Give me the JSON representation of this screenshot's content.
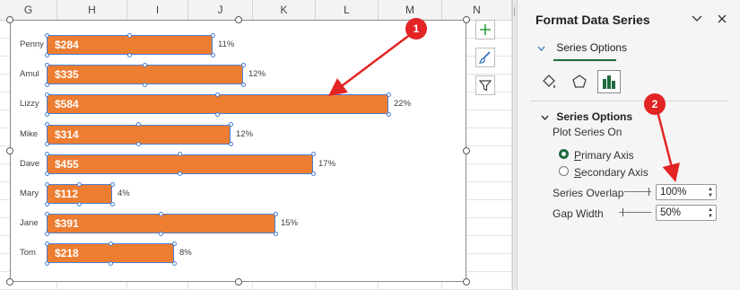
{
  "sheet": {
    "columns": [
      "G",
      "H",
      "I",
      "J",
      "K",
      "L",
      "M",
      "N"
    ]
  },
  "chart_data": {
    "type": "bar",
    "orientation": "horizontal",
    "categories": [
      "Penny",
      "Amul",
      "Lizzy",
      "Mike",
      "Dave",
      "Mary",
      "Jane",
      "Tom"
    ],
    "values": [
      284,
      335,
      584,
      314,
      455,
      112,
      391,
      218
    ],
    "value_labels": [
      "$284",
      "$335",
      "$584",
      "$314",
      "$455",
      "$112",
      "$391",
      "$218"
    ],
    "percent_labels": [
      "11%",
      "12%",
      "22%",
      "12%",
      "17%",
      "4%",
      "15%",
      "8%"
    ],
    "bar_color": "#ED7D31",
    "xlim": [
      0,
      584
    ],
    "selected": true
  },
  "chart_buttons": [
    {
      "icon": "plus-icon",
      "name": "chart-elements-button"
    },
    {
      "icon": "brush-icon",
      "name": "chart-styles-button"
    },
    {
      "icon": "filter-icon",
      "name": "chart-filters-button"
    }
  ],
  "pane": {
    "title": "Format Data Series",
    "series_options_tab": "Series Options",
    "section_title": "Series Options",
    "plot_series_on": "Plot Series On",
    "primary_axis": "Primary Axis",
    "secondary_axis": "Secondary Axis",
    "series_overlap_label": "Series Overlap",
    "series_overlap_value": "100%",
    "gap_width_label": "Gap Width",
    "gap_width_value": "50%",
    "primary_selected": true,
    "accent_color": "#1e6b3d",
    "icons": [
      "fill-line-icon",
      "effects-pentagon-icon",
      "series-options-bar-icon"
    ]
  },
  "callouts": [
    {
      "label": "1",
      "color": "#e32424"
    },
    {
      "label": "2",
      "color": "#e32424"
    }
  ]
}
